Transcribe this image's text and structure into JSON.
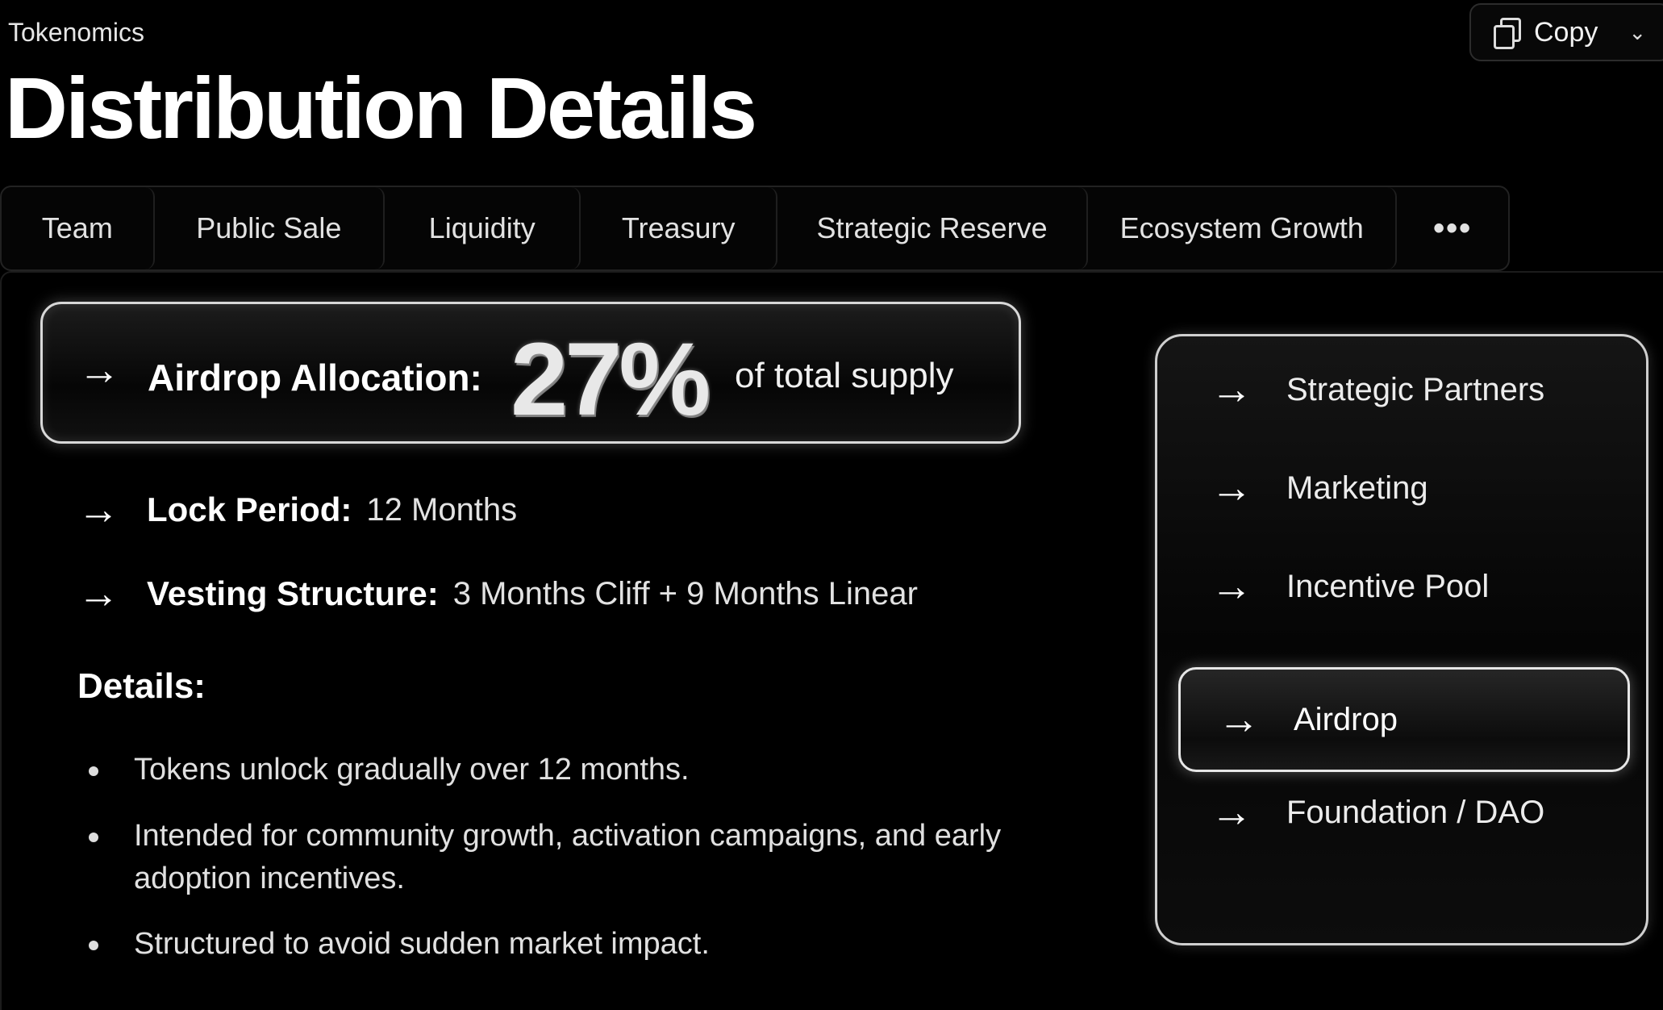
{
  "header": {
    "breadcrumb": "Tokenomics",
    "title": "Distribution Details",
    "copy_label": "Copy"
  },
  "tabs": [
    {
      "label": "Team"
    },
    {
      "label": "Public Sale"
    },
    {
      "label": "Liquidity"
    },
    {
      "label": "Treasury"
    },
    {
      "label": "Strategic Reserve"
    },
    {
      "label": "Ecosystem Growth"
    },
    {
      "label": "•••"
    }
  ],
  "allocation": {
    "label": "Airdrop Allocation:",
    "percent": "27%",
    "suffix": "of total supply"
  },
  "info": {
    "lock_key": "Lock Period:",
    "lock_value": "12 Months",
    "vesting_key": "Vesting Structure:",
    "vesting_value": "3 Months Cliff + 9 Months Linear"
  },
  "details": {
    "title": "Details:",
    "bullets": [
      "Tokens unlock gradually over 12 months.",
      "Intended for community growth, activation campaigns, and early adoption incentives.",
      "Structured to avoid sudden market impact."
    ]
  },
  "side_menu": {
    "items": [
      {
        "label": "Strategic Partners"
      },
      {
        "label": "Marketing"
      },
      {
        "label": "Incentive Pool"
      },
      {
        "label": "Airdrop",
        "active": true
      },
      {
        "label": "Foundation / DAO"
      }
    ]
  },
  "icons": {
    "arrow": "arrow-right-icon",
    "copy": "copy-icon",
    "chevron": "chevron-down-icon"
  }
}
